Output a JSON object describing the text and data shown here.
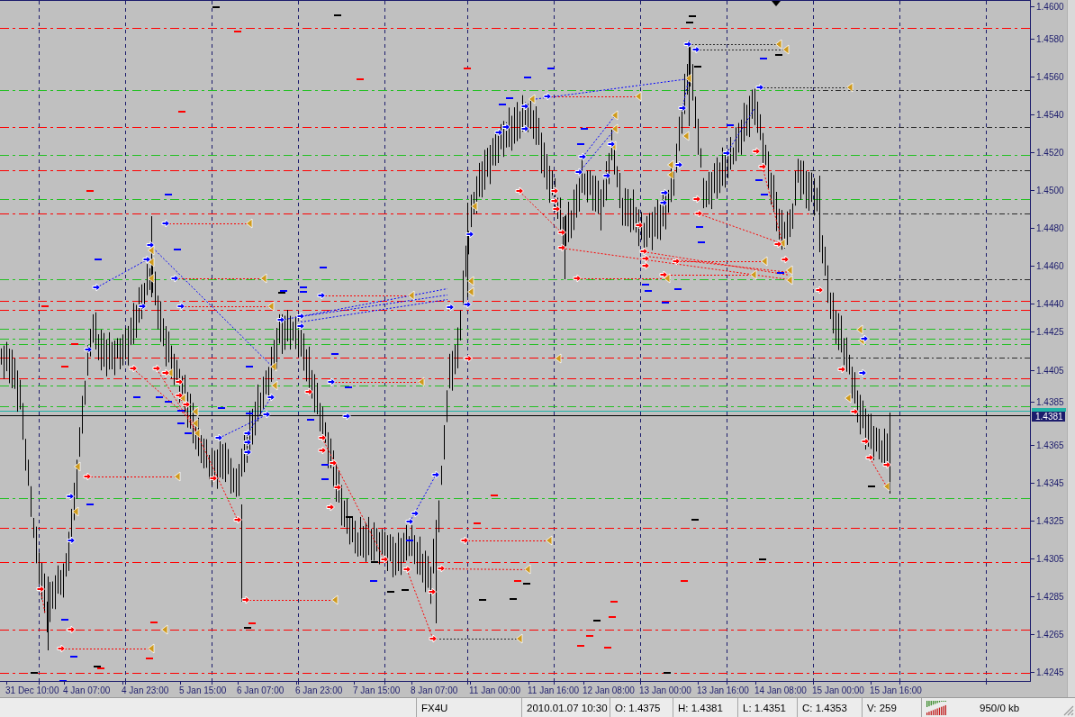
{
  "chart": {
    "price_axis": {
      "labels": [
        "1.4600",
        "1.4580",
        "1.4560",
        "1.4540",
        "1.4520",
        "1.4500",
        "1.4480",
        "1.4460",
        "1.4440",
        "1.4425",
        "1.4405",
        "1.4385",
        "1.4365",
        "1.4345",
        "1.4325",
        "1.4305",
        "1.4285",
        "1.4265",
        "1.4245"
      ],
      "current_price": "1.4381"
    },
    "time_axis": {
      "labels": [
        "31 Dec 10:00",
        "4 Jan 07:00",
        "4 Jan 23:00",
        "5 Jan 15:00",
        "6 Jan 07:00",
        "6 Jan 23:00",
        "7 Jan 15:00",
        "8 Jan 07:00",
        "11 Jan 00:00",
        "11 Jan 16:00",
        "12 Jan 08:00",
        "13 Jan 00:00",
        "13 Jan 16:00",
        "14 Jan 08:00",
        "15 Jan 00:00",
        "15 Jan 16:00"
      ]
    }
  },
  "status_bar": {
    "profile": "FX4U",
    "datetime": "2010.01.07 10:30",
    "open": "O: 1.4375",
    "high": "H: 1.4381",
    "low": "L: 1.4351",
    "close": "C: 1.4353",
    "volume": "V: 259",
    "traffic": "950/0 kb"
  }
}
